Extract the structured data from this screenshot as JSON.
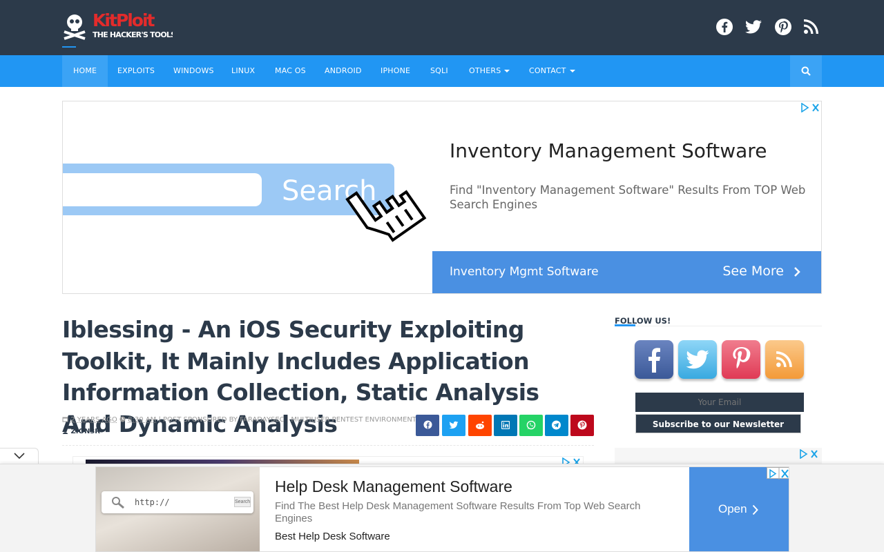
{
  "header": {
    "logo_text": "KitPloit",
    "logo_tagline": "THE HACKER'S TOOLS"
  },
  "social_top": [
    "facebook-icon",
    "twitter-icon",
    "pinterest-icon",
    "rss-icon"
  ],
  "nav": {
    "items": [
      {
        "label": "HOME"
      },
      {
        "label": "EXPLOITS"
      },
      {
        "label": "WINDOWS"
      },
      {
        "label": "LINUX"
      },
      {
        "label": "MAC OS"
      },
      {
        "label": "ANDROID"
      },
      {
        "label": "IPHONE"
      },
      {
        "label": "SQLI"
      },
      {
        "label": "OTHERS"
      },
      {
        "label": "CONTACT"
      }
    ],
    "search_icon": "search-icon"
  },
  "ad_banner": {
    "search_label": "Search",
    "title": "Inventory Management Software",
    "description": "Find \"Inventory Management Software\" Results From TOP Web Search Engines",
    "link": "Inventory Mgmt Software",
    "cta": "See More"
  },
  "article": {
    "title": "Iblessing - An iOS Security Exploiting Toolkit, It Mainly Includes Application Information Collection, Static Analysis And Dynamic Analysis",
    "date": "2 YEARS AGO",
    "time": "8:30 AM",
    "sponsor": "| POST SPONSORED BY FARADAYSEC | MULTIUSER PENTEST ENVIRONMENT",
    "author": "ZION3R"
  },
  "share_buttons": [
    {
      "icon": "facebook-icon",
      "color": "#3b5998"
    },
    {
      "icon": "twitter-icon",
      "color": "#1da1f2"
    },
    {
      "icon": "reddit-icon",
      "color": "#ff4500"
    },
    {
      "icon": "linkedin-icon",
      "color": "#0077b5"
    },
    {
      "icon": "whatsapp-icon",
      "color": "#25d366"
    },
    {
      "icon": "telegram-icon",
      "color": "#0088cc"
    },
    {
      "icon": "pinterest-icon",
      "color": "#bd081c"
    }
  ],
  "sidebar": {
    "title": "FOLLOW US!",
    "email_placeholder": "Your Email",
    "subscribe_label": "Subscribe to our Newsletter"
  },
  "bottom_ad": {
    "url_text": "http://",
    "url_button": "Search",
    "title": "Help Desk Management Software",
    "description": "Find The Best Help Desk Management Software Results From Top Web Search Engines",
    "link": "Best Help Desk Software",
    "cta": "Open"
  },
  "colors": {
    "header_bg": "#2c3a4a",
    "nav_bg": "#2196f3",
    "ad_blue": "#4a90e2"
  }
}
